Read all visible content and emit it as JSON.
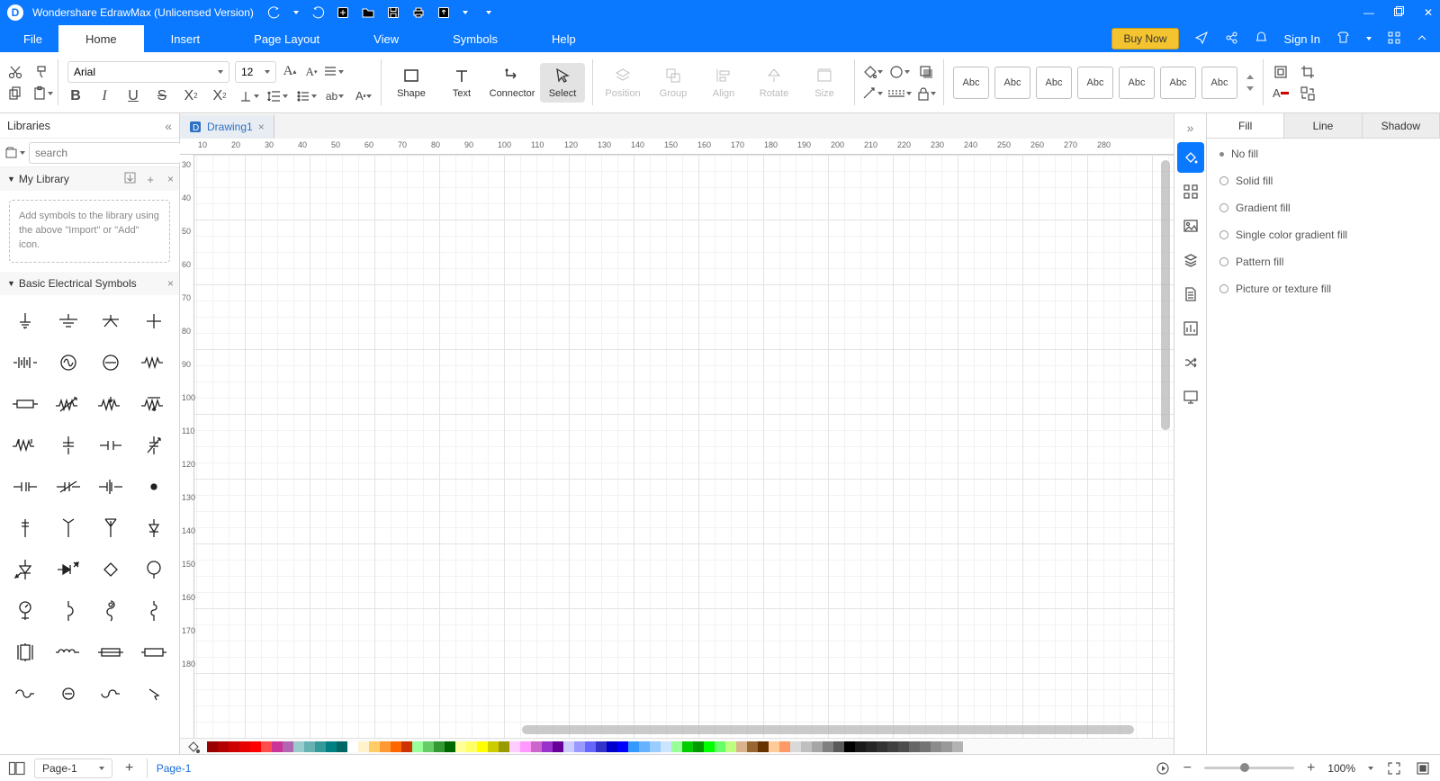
{
  "title": "Wondershare EdrawMax (Unlicensed Version)",
  "menu": {
    "file": "File",
    "tabs": [
      "Home",
      "Insert",
      "Page Layout",
      "View",
      "Symbols",
      "Help"
    ],
    "active": "Home"
  },
  "top_right": {
    "buy": "Buy Now",
    "signin": "Sign In"
  },
  "font": {
    "family": "Arial",
    "size": "12"
  },
  "tools": {
    "shape": "Shape",
    "text": "Text",
    "connector": "Connector",
    "select": "Select",
    "position": "Position",
    "group": "Group",
    "align": "Align",
    "rotate": "Rotate",
    "size": "Size"
  },
  "shape_style_label": "Abc",
  "library": {
    "title": "Libraries",
    "search_ph": "search",
    "sections": {
      "mylib": "My Library",
      "basic_elec": "Basic Electrical Symbols"
    },
    "mylib_hint": "Add symbols to the library using the above \"Import\" or \"Add\" icon."
  },
  "tab_doc": "Drawing1",
  "ruler_h": [
    "10",
    "20",
    "30",
    "40",
    "50",
    "60",
    "70",
    "80",
    "90",
    "100",
    "110",
    "120",
    "130",
    "140",
    "150",
    "160",
    "170",
    "180",
    "190",
    "200",
    "210",
    "220",
    "230",
    "240",
    "250",
    "260",
    "270",
    "280"
  ],
  "ruler_v": [
    "30",
    "40",
    "50",
    "60",
    "70",
    "80",
    "90",
    "100",
    "110",
    "120",
    "130",
    "140",
    "150",
    "160",
    "170",
    "180"
  ],
  "prop": {
    "tabs": [
      "Fill",
      "Line",
      "Shadow"
    ],
    "active": "Fill",
    "options": [
      "No fill",
      "Solid fill",
      "Gradient fill",
      "Single color gradient fill",
      "Pattern fill",
      "Picture or texture fill"
    ]
  },
  "colorbar": [
    "#990000",
    "#b30000",
    "#cc0000",
    "#e60000",
    "#ff0000",
    "#ff4d4d",
    "#cc3399",
    "#b266b2",
    "#99cccc",
    "#66b2b2",
    "#339999",
    "#008080",
    "#006666",
    "#ffffff",
    "#fff2cc",
    "#ffcc66",
    "#ff9933",
    "#ff6600",
    "#cc3300",
    "#99ff99",
    "#66cc66",
    "#339933",
    "#006600",
    "#ffff99",
    "#ffff66",
    "#ffff00",
    "#cccc00",
    "#999900",
    "#ffccff",
    "#ff99ff",
    "#cc66cc",
    "#9933cc",
    "#660099",
    "#ccccff",
    "#9999ff",
    "#6666ff",
    "#3333cc",
    "#0000cc",
    "#0000ff",
    "#3399ff",
    "#66b2ff",
    "#99ccff",
    "#cce5ff",
    "#99ff99",
    "#00cc00",
    "#009900",
    "#00ff00",
    "#66ff66",
    "#bfff80",
    "#d9b38c",
    "#996633",
    "#663300",
    "#ffcc99",
    "#ff9966",
    "#d9d9d9",
    "#bfbfbf",
    "#a6a6a6",
    "#808080",
    "#595959",
    "#000000",
    "#1a1a1a",
    "#262626",
    "#333333",
    "#404040",
    "#4d4d4d",
    "#666666",
    "#737373",
    "#8c8c8c",
    "#999999",
    "#b3b3b3"
  ],
  "status": {
    "page_sel": "Page-1",
    "page_link": "Page-1",
    "zoom": "100%"
  }
}
